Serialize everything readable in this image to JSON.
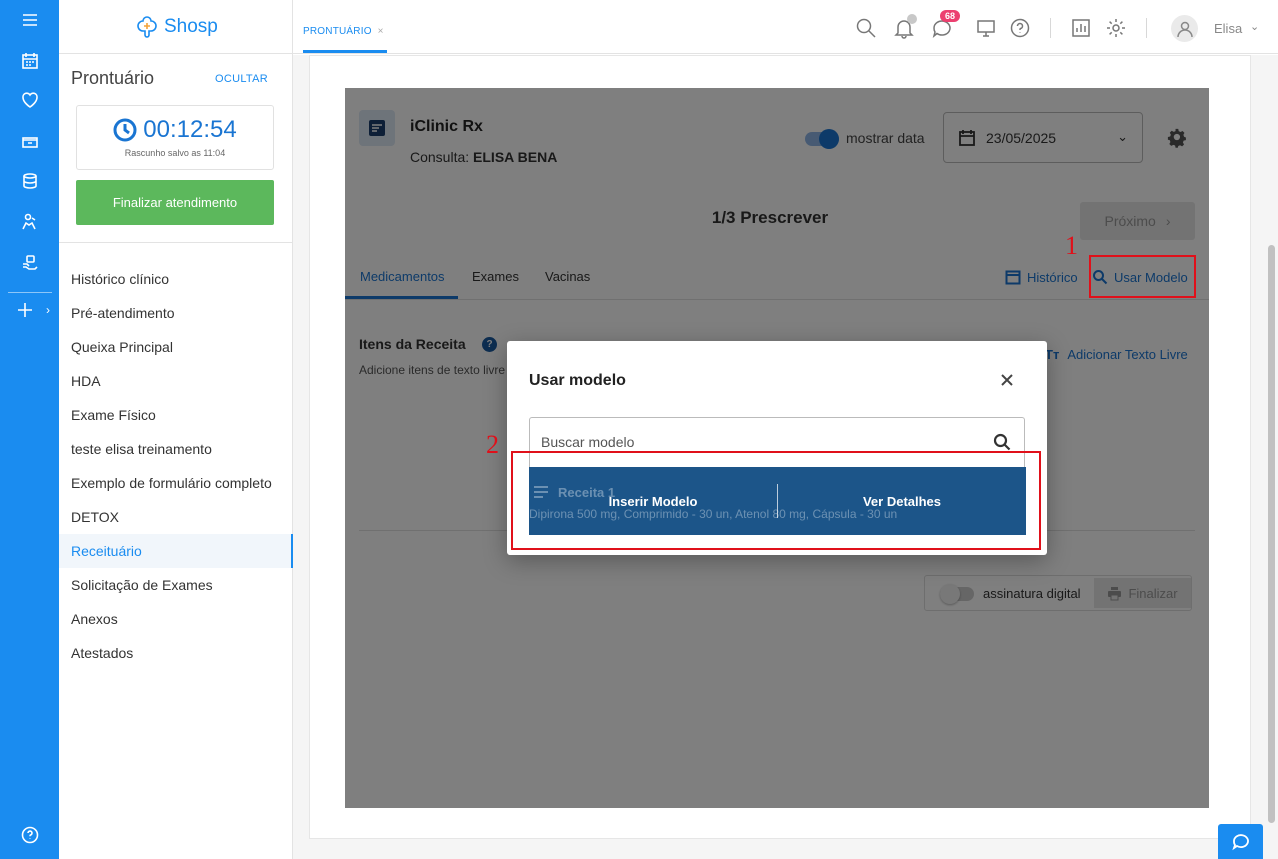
{
  "sidebar": {
    "logo_text": "Shosp",
    "title": "Prontuário",
    "hide_label": "OCULTAR",
    "timer": "00:12:54",
    "draft_saved": "Rascunho salvo as 11:04",
    "finalize_label": "Finalizar atendimento",
    "items": [
      {
        "label": "Histórico clínico",
        "active": false
      },
      {
        "label": "Pré-atendimento",
        "active": false
      },
      {
        "label": "Queixa Principal",
        "active": false
      },
      {
        "label": "HDA",
        "active": false
      },
      {
        "label": "Exame Físico",
        "active": false
      },
      {
        "label": "teste elisa treinamento",
        "active": false
      },
      {
        "label": "Exemplo de formulário completo",
        "active": false
      },
      {
        "label": "DETOX",
        "active": false
      },
      {
        "label": "Receituário",
        "active": true
      },
      {
        "label": "Solicitação de Exames",
        "active": false
      },
      {
        "label": "Anexos",
        "active": false
      },
      {
        "label": "Atestados",
        "active": false
      }
    ]
  },
  "topbar": {
    "tab_label": "PRONTUÁRIO",
    "tab_close": "×",
    "messages_badge": "68",
    "user_name": "Elisa",
    "icons": [
      "search-icon",
      "bell-icon",
      "chat-icon",
      "monitor-icon",
      "help-icon",
      "report-icon",
      "gear-icon",
      "user-icon"
    ]
  },
  "rx": {
    "title": "iClinic Rx",
    "consult_label": "Consulta:",
    "patient": "ELISA BENA",
    "show_date_label": "mostrar data",
    "show_date_on": true,
    "date": "23/05/2025",
    "step": "1/3 Prescrever",
    "next_label": "Próximo",
    "tabs": [
      "Medicamentos",
      "Exames",
      "Vacinas"
    ],
    "history_label": "Histórico",
    "use_model_label": "Usar Modelo",
    "items_title": "Itens da Receita",
    "items_sub": "Adicione itens de texto livre",
    "add_free_text_label": "Adicionar Texto Livre",
    "digital_signature_label": "assinatura digital",
    "digital_signature_on": false,
    "finalize_label": "Finalizar"
  },
  "modal": {
    "title": "Usar modelo",
    "search_placeholder": "Buscar modelo",
    "row": {
      "name": "Receita 1",
      "description": "Dipirona 500 mg, Comprimido - 30 un, Atenol 80 mg, Cápsula - 30 un",
      "insert_label": "Inserir Modelo",
      "details_label": "Ver Detalhes"
    }
  },
  "annotations": {
    "one": "1",
    "two": "2",
    "color": "#e0101a"
  },
  "colors": {
    "brand": "#1a8cf0",
    "primary_dark": "#1c5589",
    "success": "#5cb85c",
    "badge": "#ec4070"
  }
}
